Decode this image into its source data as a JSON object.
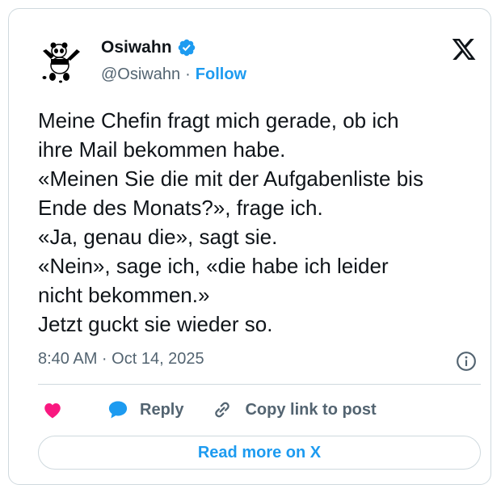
{
  "author": {
    "name": "Osiwahn",
    "handle": "@Osiwahn",
    "separator": "·",
    "follow_label": "Follow"
  },
  "post": {
    "lines": [
      "Meine Chefin fragt mich gerade, ob ich",
      "ihre Mail bekommen habe.",
      "«Meinen Sie die mit der Aufgabenliste bis",
      "Ende des Monats?», frage ich.",
      "«Ja, genau die», sagt sie.",
      "«Nein», sage ich, «die habe ich leider",
      "nicht bekommen.»",
      "Jetzt guckt sie wieder so."
    ],
    "timestamp": "8:40 AM · Oct 14, 2025"
  },
  "actions": {
    "reply_label": "Reply",
    "copy_link_label": "Copy link to post",
    "read_more_label": "Read more on X"
  },
  "colors": {
    "accent": "#1d9bf0",
    "like": "#f91880",
    "verified": "#1d9bf0",
    "muted_text": "#536471",
    "border": "#cfd9de"
  },
  "icons": [
    "panda-avatar",
    "verified-badge-icon",
    "x-logo-icon",
    "info-icon",
    "heart-icon",
    "reply-bubble-icon",
    "link-icon"
  ]
}
